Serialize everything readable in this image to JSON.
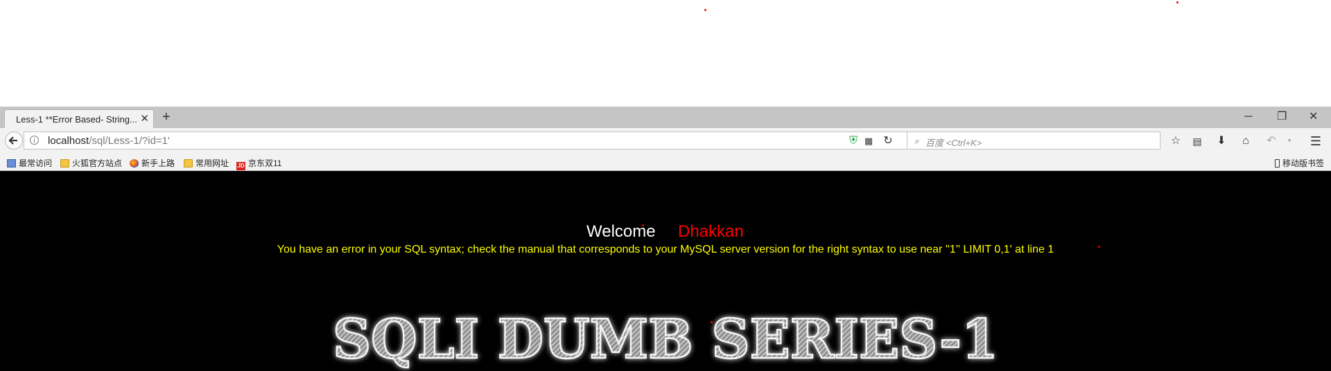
{
  "tab": {
    "title": "Less-1 **Error Based- String...",
    "close_icon": "close-icon"
  },
  "address_bar": {
    "host": "localhost",
    "path": "/sql/Less-1/?id=1'"
  },
  "search": {
    "placeholder": "百度 <Ctrl+K>"
  },
  "bookmarks": [
    {
      "label": "最常访问",
      "icon": "most-visited-icon"
    },
    {
      "label": "火狐官方站点",
      "icon": "folder-icon"
    },
    {
      "label": "新手上路",
      "icon": "firefox-icon"
    },
    {
      "label": "常用网址",
      "icon": "folder-icon"
    },
    {
      "label": "京东双11",
      "icon": "jd-icon"
    }
  ],
  "mobile_bookmarks": "移动版书签",
  "content": {
    "welcome": "Welcome",
    "username": "Dhakkan",
    "error": "You have an error in your SQL syntax; check the manual that corresponds to your MySQL server version for the right syntax to use near ''1'' LIMIT 0,1' at line 1",
    "banner": "SQLI DUMB SERIES-1"
  },
  "colors": {
    "page_bg": "#000000",
    "username": "#ff0000",
    "error": "#ffff00"
  }
}
